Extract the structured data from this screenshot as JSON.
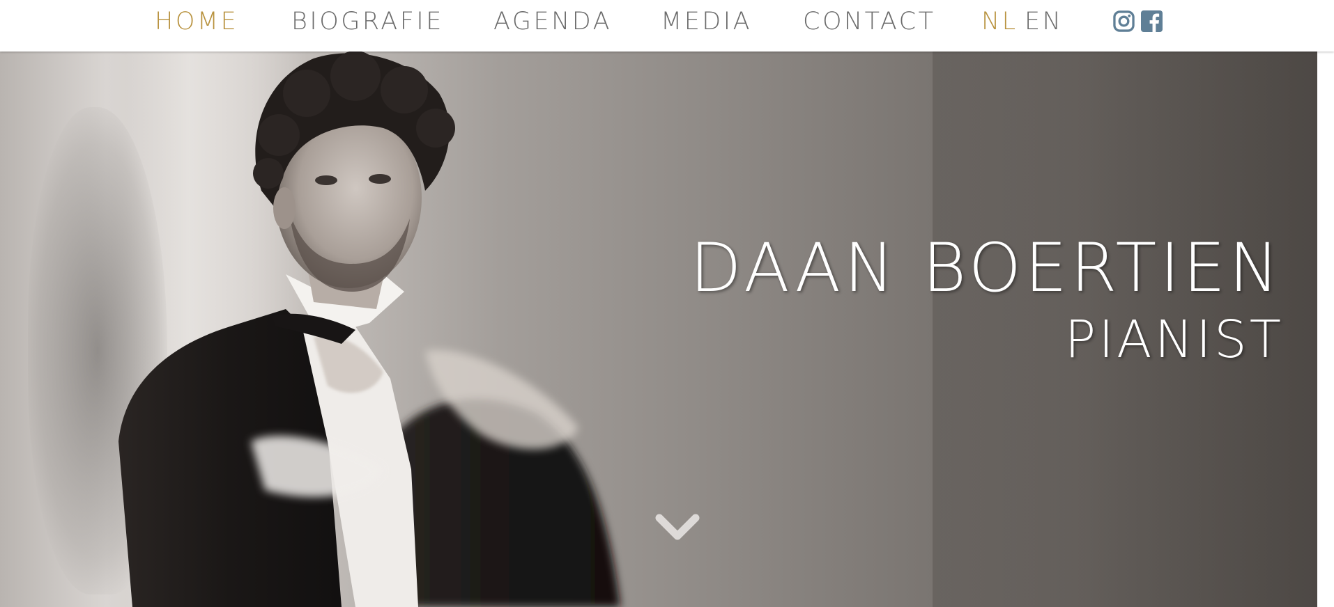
{
  "nav": {
    "items": [
      {
        "label": "HOME",
        "active": true
      },
      {
        "label": "BIOGRAFIE",
        "active": false
      },
      {
        "label": "AGENDA",
        "active": false
      },
      {
        "label": "MEDIA",
        "active": false
      },
      {
        "label": "CONTACT",
        "active": false
      }
    ],
    "language": {
      "nl": "NL",
      "en": "EN",
      "active": "NL"
    },
    "social": [
      "instagram-icon",
      "facebook-icon"
    ]
  },
  "hero": {
    "name": "DAAN BOERTIEN",
    "subtitle": "PIANIST",
    "scroll_icon": "chevron-down-icon"
  },
  "colors": {
    "accent": "#b8923e",
    "nav_text": "#6b6b6b",
    "social": "#5f7f96",
    "hero_text": "#ffffff"
  }
}
